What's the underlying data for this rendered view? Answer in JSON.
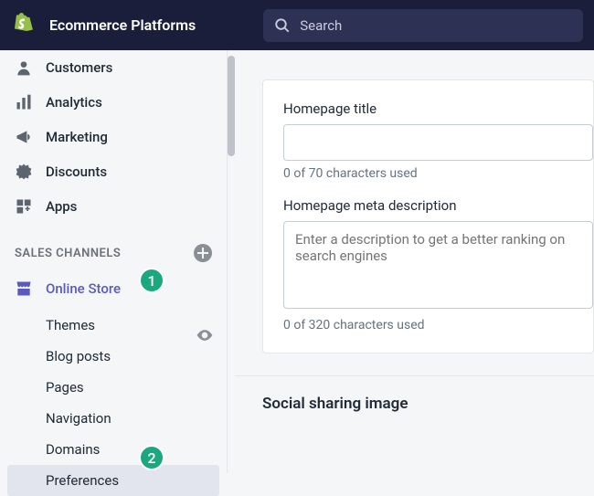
{
  "brand": "Ecommerce Platforms",
  "search": {
    "placeholder": "Search"
  },
  "nav": {
    "customers": "Customers",
    "analytics": "Analytics",
    "marketing": "Marketing",
    "discounts": "Discounts",
    "apps": "Apps"
  },
  "section_sales_channels": "SALES CHANNELS",
  "online_store": {
    "label": "Online Store",
    "themes": "Themes",
    "blog_posts": "Blog posts",
    "pages": "Pages",
    "navigation": "Navigation",
    "domains": "Domains",
    "preferences": "Preferences"
  },
  "form": {
    "homepage_title_label": "Homepage title",
    "homepage_title_hint": "0 of 70 characters used",
    "homepage_meta_label": "Homepage meta description",
    "homepage_meta_placeholder": "Enter a description to get a better ranking on search engines",
    "homepage_meta_hint": "0 of 320 characters used",
    "social_heading": "Social sharing image"
  },
  "annotations": {
    "badge1": "1",
    "badge2": "2"
  }
}
